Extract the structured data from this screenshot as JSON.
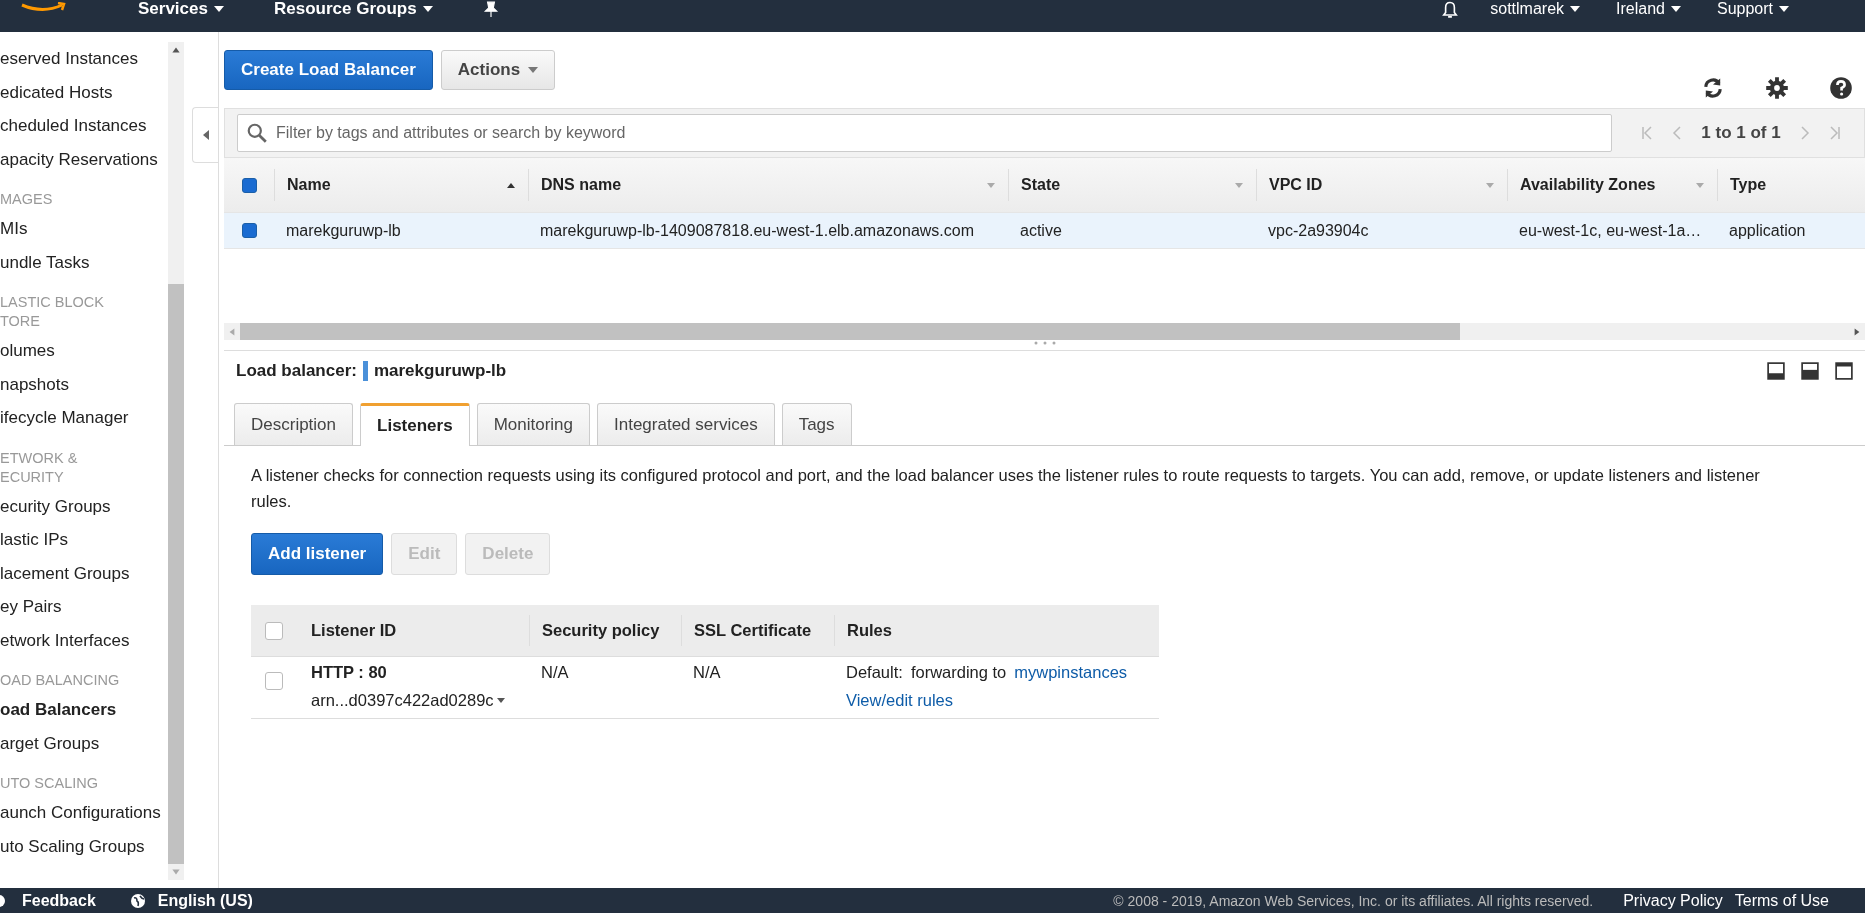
{
  "top_nav": {
    "left": [
      {
        "label": "Services"
      },
      {
        "label": "Resource Groups"
      }
    ],
    "right": [
      {
        "label": "sottlmarek"
      },
      {
        "label": "Ireland"
      },
      {
        "label": "Support"
      }
    ]
  },
  "sidebar": {
    "sections": [
      {
        "items": [
          {
            "label": "eserved Instances",
            "selected": false
          },
          {
            "label": "edicated Hosts",
            "selected": false
          },
          {
            "label": "cheduled Instances",
            "selected": false
          },
          {
            "label": "apacity Reservations",
            "selected": false
          }
        ]
      },
      {
        "heading": [
          "MAGES"
        ],
        "items": [
          {
            "label": "MIs",
            "selected": false
          },
          {
            "label": "undle Tasks",
            "selected": false
          }
        ]
      },
      {
        "heading": [
          "LASTIC BLOCK",
          "TORE"
        ],
        "items": [
          {
            "label": "olumes",
            "selected": false
          },
          {
            "label": "napshots",
            "selected": false
          },
          {
            "label": "ifecycle Manager",
            "selected": false
          }
        ]
      },
      {
        "heading": [
          "ETWORK &",
          "ECURITY"
        ],
        "items": [
          {
            "label": "ecurity Groups",
            "selected": false
          },
          {
            "label": "lastic IPs",
            "selected": false
          },
          {
            "label": "lacement Groups",
            "selected": false
          },
          {
            "label": "ey Pairs",
            "selected": false
          },
          {
            "label": "etwork Interfaces",
            "selected": false
          }
        ]
      },
      {
        "heading": [
          "OAD BALANCING"
        ],
        "items": [
          {
            "label": "oad Balancers",
            "selected": true
          },
          {
            "label": "arget Groups",
            "selected": false
          }
        ]
      },
      {
        "heading": [
          "UTO SCALING"
        ],
        "items": [
          {
            "label": "aunch Configurations",
            "selected": false
          },
          {
            "label": "uto Scaling Groups",
            "selected": false
          }
        ]
      }
    ]
  },
  "toolbar": {
    "primary": "Create Load Balancer",
    "actions": "Actions"
  },
  "filter": {
    "placeholder": "Filter by tags and attributes or search by keyword",
    "pagination": "1 to 1 of 1"
  },
  "table": {
    "header_checked": true,
    "columns": [
      {
        "label": "Name",
        "sorted": true,
        "filterable": false
      },
      {
        "label": "DNS name",
        "sorted": false,
        "filterable": true
      },
      {
        "label": "State",
        "sorted": false,
        "filterable": true
      },
      {
        "label": "VPC ID",
        "sorted": false,
        "filterable": true
      },
      {
        "label": "Availability Zones",
        "sorted": false,
        "filterable": true
      },
      {
        "label": "Type",
        "sorted": false,
        "filterable": false
      }
    ],
    "rows": [
      {
        "selected": true,
        "cells": [
          "marekguruwp-lb",
          "marekguruwp-lb-1409087818.eu-west-1.elb.amazonaws.com",
          "active",
          "vpc-2a93904c",
          "eu-west-1c, eu-west-1a…",
          "application"
        ]
      }
    ]
  },
  "details": {
    "label": "Load balancer:",
    "name": "marekguruwp-lb",
    "tabs": [
      {
        "label": "Description",
        "selected": false
      },
      {
        "label": "Listeners",
        "selected": true
      },
      {
        "label": "Monitoring",
        "selected": false
      },
      {
        "label": "Integrated services",
        "selected": false
      },
      {
        "label": "Tags",
        "selected": false
      }
    ],
    "intro": "A listener checks for connection requests using its configured protocol and port, and the load balancer uses the listener rules to route requests to targets. You can add, remove, or update listeners and listener rules.",
    "buttons": [
      {
        "label": "Add listener",
        "kind": "primary",
        "disabled": false
      },
      {
        "label": "Edit",
        "kind": "plain",
        "disabled": true
      },
      {
        "label": "Delete",
        "kind": "plain",
        "disabled": true
      }
    ],
    "listeners": {
      "header_checked": false,
      "columns": [
        "Listener ID",
        "Security policy",
        "SSL Certificate",
        "Rules"
      ],
      "rows": [
        {
          "checked": false,
          "protocol": "HTTP : 80",
          "arn": "arn...d0397c422ad0289c",
          "security_policy": "N/A",
          "ssl_certificate": "N/A",
          "rule_label": "Default:",
          "rule_text": "forwarding to",
          "rule_target": "mywpinstances",
          "rules_link": "View/edit rules"
        }
      ]
    }
  },
  "footer": {
    "feedback": "Feedback",
    "language": "English (US)",
    "copyright": "© 2008 - 2019, Amazon Web Services, Inc. or its affiliates. All rights reserved.",
    "links": [
      "Privacy Policy",
      "Terms of Use"
    ]
  }
}
